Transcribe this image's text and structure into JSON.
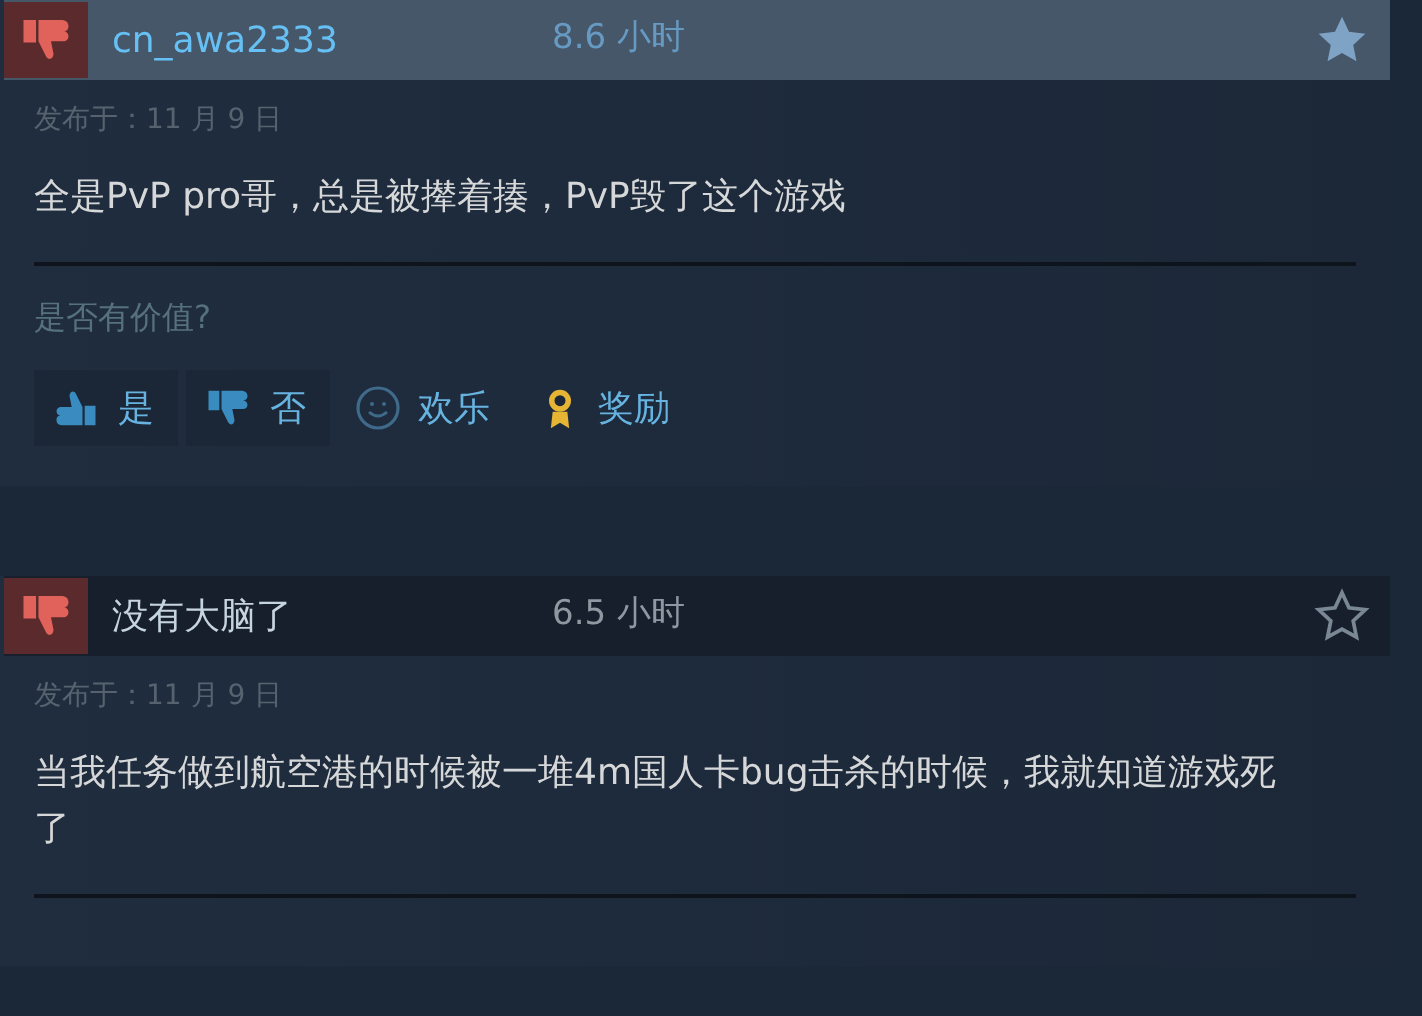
{
  "reviews": [
    {
      "author": "cn_awa2333",
      "hours": "8.6 小时",
      "highlighted": true,
      "posted": "发布于：11 月 9 日",
      "text": "全是PvP pro哥，总是被撵着揍，PvP毁了这个游戏",
      "helpful_prompt": "是否有价值?",
      "actions": [
        {
          "kind": "yes",
          "label": "是"
        },
        {
          "kind": "no",
          "label": "否"
        },
        {
          "kind": "funny",
          "label": "欢乐"
        },
        {
          "kind": "award",
          "label": "奖励"
        }
      ]
    },
    {
      "author": "没有大脑了",
      "hours": "6.5 小时",
      "highlighted": false,
      "posted": "发布于：11 月 9 日",
      "text": "当我任务做到航空港的时候被一堆4m国人卡bug击杀的时候，我就知道游戏死了"
    }
  ]
}
